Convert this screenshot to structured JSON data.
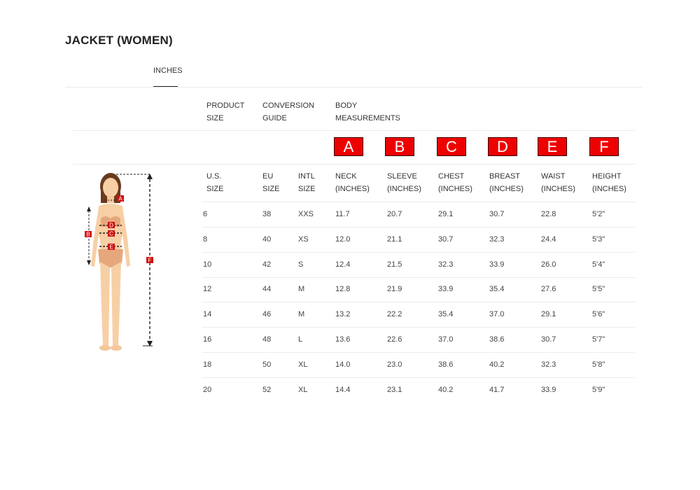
{
  "title": "JACKET (WOMEN)",
  "tab": {
    "label": "INCHES"
  },
  "group_headers": {
    "product_size": [
      "PRODUCT",
      "SIZE"
    ],
    "conversion_guide": [
      "CONVERSION",
      "GUIDE"
    ],
    "body_measurements": [
      "BODY",
      "MEASUREMENTS"
    ]
  },
  "letters": [
    "A",
    "B",
    "C",
    "D",
    "E",
    "F"
  ],
  "columns": [
    [
      "U.S.",
      "SIZE"
    ],
    [
      "EU",
      "SIZE"
    ],
    [
      "INTL",
      "SIZE"
    ],
    [
      "NECK",
      "(INCHES)"
    ],
    [
      "SLEEVE",
      "(INCHES)"
    ],
    [
      "CHEST",
      "(INCHES)"
    ],
    [
      "BREAST",
      "(INCHES)"
    ],
    [
      "WAIST",
      "(INCHES)"
    ],
    [
      "HEIGHT",
      "(INCHES)"
    ]
  ],
  "rows": [
    [
      "6",
      "38",
      "XXS",
      "11.7",
      "20.7",
      "29.1",
      "30.7",
      "22.8",
      "5'2\""
    ],
    [
      "8",
      "40",
      "XS",
      "12.0",
      "21.1",
      "30.7",
      "32.3",
      "24.4",
      "5'3\""
    ],
    [
      "10",
      "42",
      "S",
      "12.4",
      "21.5",
      "32.3",
      "33.9",
      "26.0",
      "5'4\""
    ],
    [
      "12",
      "44",
      "M",
      "12.8",
      "21.9",
      "33.9",
      "35.4",
      "27.6",
      "5'5\""
    ],
    [
      "14",
      "46",
      "M",
      "13.2",
      "22.2",
      "35.4",
      "37.0",
      "29.1",
      "5'6\""
    ],
    [
      "16",
      "48",
      "L",
      "13.6",
      "22.6",
      "37.0",
      "38.6",
      "30.7",
      "5'7\""
    ],
    [
      "18",
      "50",
      "XL",
      "14.0",
      "23.0",
      "38.6",
      "40.2",
      "32.3",
      "5'8\""
    ],
    [
      "20",
      "52",
      "XL",
      "14.4",
      "23.1",
      "40.2",
      "41.7",
      "33.9",
      "5'9\""
    ]
  ],
  "figure_markers": [
    "A",
    "B",
    "C",
    "D",
    "E",
    "F"
  ],
  "colors": {
    "badge": "#ee0000",
    "marker": "#d01010"
  }
}
